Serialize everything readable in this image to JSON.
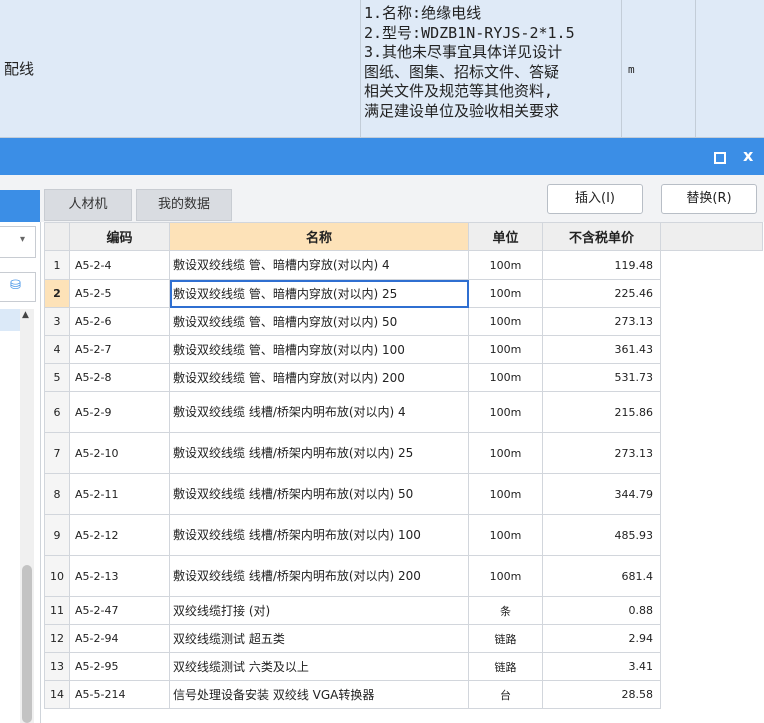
{
  "spreadsheet_row": {
    "name": "配线",
    "description_lines": [
      "1.名称:绝缘电线",
      "2.型号:WDZB1N-RYJS-2*1.5",
      "3.其他未尽事宜具体详见设计",
      "图纸、图集、招标文件、答疑",
      "相关文件及规范等其他资料,",
      "满足建设单位及验收相关要求"
    ],
    "unit": "m"
  },
  "window": {
    "restore_icon": "restore-icon",
    "close_label": "x"
  },
  "tabs": [
    {
      "label": "人材机"
    },
    {
      "label": "我的数据"
    }
  ],
  "buttons": {
    "insert": "插入(I)",
    "replace": "替换(R)"
  },
  "table": {
    "columns": [
      "编码",
      "名称",
      "单位",
      "不含税单价"
    ],
    "selected_row": 2,
    "rows": [
      {
        "no": "1",
        "code": "A5-2-4",
        "name": "敷设双绞线缆 管、暗槽内穿放(对以内) 4",
        "unit": "100m",
        "price": "119.48"
      },
      {
        "no": "2",
        "code": "A5-2-5",
        "name": "敷设双绞线缆 管、暗槽内穿放(对以内) 25",
        "unit": "100m",
        "price": "225.46"
      },
      {
        "no": "3",
        "code": "A5-2-6",
        "name": "敷设双绞线缆 管、暗槽内穿放(对以内) 50",
        "unit": "100m",
        "price": "273.13"
      },
      {
        "no": "4",
        "code": "A5-2-7",
        "name": "敷设双绞线缆 管、暗槽内穿放(对以内) 100",
        "unit": "100m",
        "price": "361.43"
      },
      {
        "no": "5",
        "code": "A5-2-8",
        "name": "敷设双绞线缆 管、暗槽内穿放(对以内) 200",
        "unit": "100m",
        "price": "531.73"
      },
      {
        "no": "6",
        "code": "A5-2-9",
        "name": "敷设双绞线缆 线槽/桥架内明布放(对以内) 4",
        "unit": "100m",
        "price": "215.86"
      },
      {
        "no": "7",
        "code": "A5-2-10",
        "name": "敷设双绞线缆 线槽/桥架内明布放(对以内) 25",
        "unit": "100m",
        "price": "273.13"
      },
      {
        "no": "8",
        "code": "A5-2-11",
        "name": "敷设双绞线缆 线槽/桥架内明布放(对以内) 50",
        "unit": "100m",
        "price": "344.79"
      },
      {
        "no": "9",
        "code": "A5-2-12",
        "name": "敷设双绞线缆 线槽/桥架内明布放(对以内) 100",
        "unit": "100m",
        "price": "485.93"
      },
      {
        "no": "10",
        "code": "A5-2-13",
        "name": "敷设双绞线缆 线槽/桥架内明布放(对以内) 200",
        "unit": "100m",
        "price": "681.4"
      },
      {
        "no": "11",
        "code": "A5-2-47",
        "name": "双绞线缆打接 (对)",
        "unit": "条",
        "price": "0.88"
      },
      {
        "no": "12",
        "code": "A5-2-94",
        "name": "双绞线缆测试 超五类",
        "unit": "链路",
        "price": "2.94"
      },
      {
        "no": "13",
        "code": "A5-2-95",
        "name": "双绞线缆测试 六类及以上",
        "unit": "链路",
        "price": "3.41"
      },
      {
        "no": "14",
        "code": "A5-5-214",
        "name": "信号处理设备安装 双绞线 VGA转换器",
        "unit": "台",
        "price": "28.58"
      }
    ]
  },
  "colors": {
    "titlebar": "#3b8ee6",
    "header_highlight": "#fde2b8",
    "selection_border": "#2f6fd1",
    "spreadsheet_bg": "#dfeaf7"
  }
}
